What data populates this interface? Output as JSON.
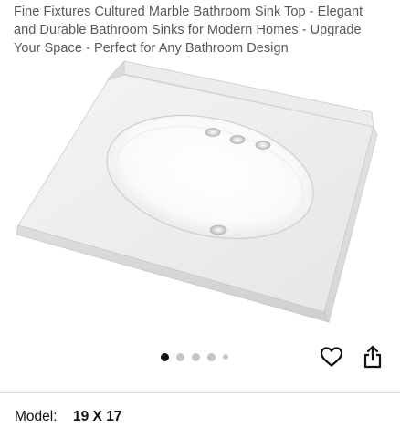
{
  "product": {
    "title": "Fine Fixtures Cultured Marble Bathroom Sink Top - Elegant and Durable Bathroom Sinks for Modern Homes - Upgrade Your Space - Perfect for Any Bathroom Design"
  },
  "gallery": {
    "image_count": 5,
    "active_index": 0
  },
  "actions": {
    "favorite_icon": "heart-icon",
    "share_icon": "share-icon"
  },
  "specs": [
    {
      "label": "Model:",
      "value": "19 X 17"
    }
  ],
  "colors": {
    "dot_active": "#111111",
    "dot_inactive": "#c4c6c6",
    "title_text": "#565959"
  }
}
